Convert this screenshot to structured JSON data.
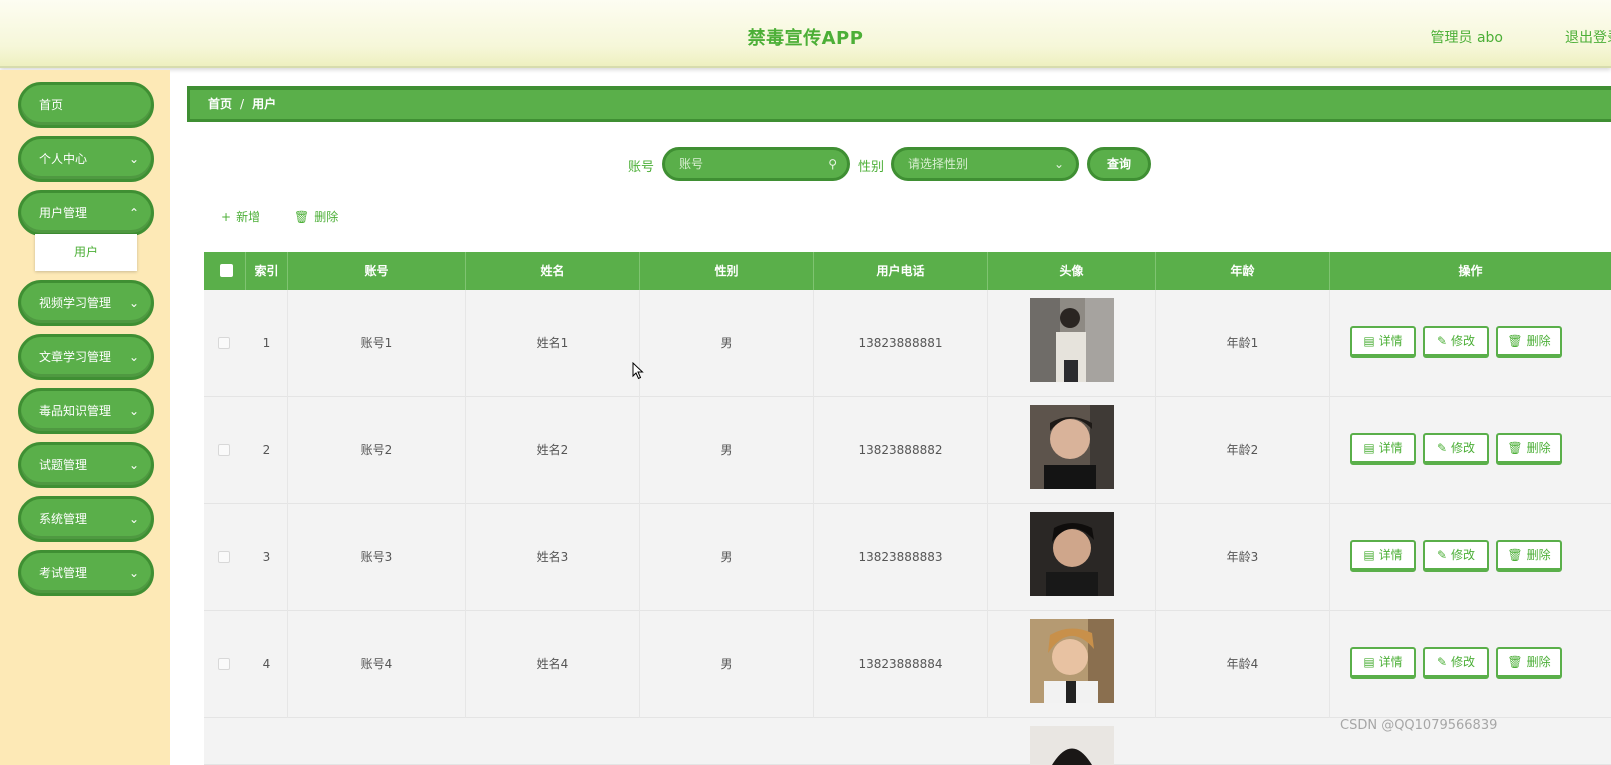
{
  "header": {
    "title": "禁毒宣传APP",
    "admin": "管理员 abo",
    "logout": "退出登录"
  },
  "sidebar": {
    "items": [
      {
        "label": "首页",
        "has_children": false
      },
      {
        "label": "个人中心",
        "has_children": true
      },
      {
        "label": "用户管理",
        "has_children": true
      },
      {
        "label": "视频学习管理",
        "has_children": true
      },
      {
        "label": "文章学习管理",
        "has_children": true
      },
      {
        "label": "毒品知识管理",
        "has_children": true
      },
      {
        "label": "试题管理",
        "has_children": true
      },
      {
        "label": "系统管理",
        "has_children": true
      },
      {
        "label": "考试管理",
        "has_children": true
      }
    ],
    "submenu": {
      "label": "用户"
    }
  },
  "breadcrumb": {
    "home": "首页",
    "sep": "/",
    "current": "用户"
  },
  "search": {
    "account_label": "账号",
    "account_placeholder": "账号",
    "gender_label": "性别",
    "gender_placeholder": "请选择性别",
    "query_button": "查询"
  },
  "actions": {
    "add": "新增",
    "delete": "删除"
  },
  "table": {
    "columns": [
      "索引",
      "账号",
      "姓名",
      "性别",
      "用户电话",
      "头像",
      "年龄",
      "操作"
    ],
    "rows": [
      {
        "index": "1",
        "account": "账号1",
        "name": "姓名1",
        "gender": "男",
        "phone": "13823888881",
        "age": "年龄1"
      },
      {
        "index": "2",
        "account": "账号2",
        "name": "姓名2",
        "gender": "男",
        "phone": "13823888882",
        "age": "年龄2"
      },
      {
        "index": "3",
        "account": "账号3",
        "name": "姓名3",
        "gender": "男",
        "phone": "13823888883",
        "age": "年龄3"
      },
      {
        "index": "4",
        "account": "账号4",
        "name": "姓名4",
        "gender": "男",
        "phone": "13823888884",
        "age": "年龄4"
      }
    ],
    "row_actions": {
      "detail": "详情",
      "edit": "修改",
      "delete": "删除"
    }
  },
  "watermark": "CSDN @QQ1079566839",
  "colors": {
    "accent": "#5aaf4a",
    "accent_dark": "#3f8f33",
    "sidebar_bg": "#fde9b6",
    "header_text": "#4caf37"
  }
}
